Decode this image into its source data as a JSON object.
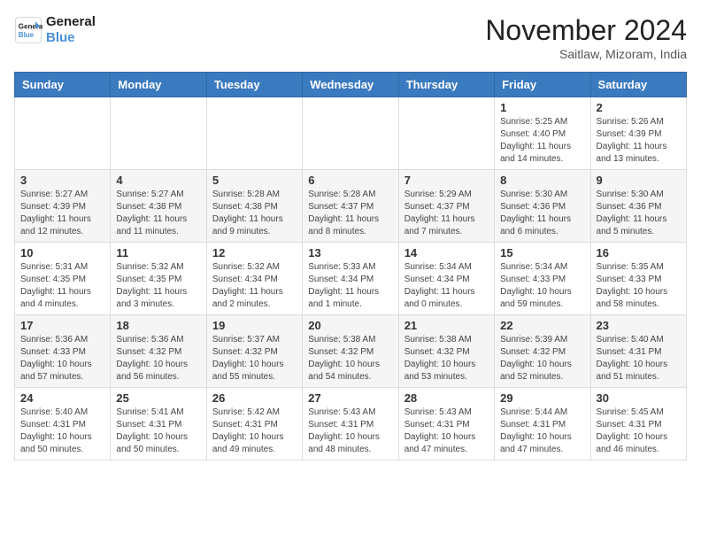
{
  "header": {
    "logo_line1": "General",
    "logo_line2": "Blue",
    "month_title": "November 2024",
    "location": "Saitlaw, Mizoram, India"
  },
  "weekdays": [
    "Sunday",
    "Monday",
    "Tuesday",
    "Wednesday",
    "Thursday",
    "Friday",
    "Saturday"
  ],
  "weeks": [
    [
      {
        "day": "",
        "info": ""
      },
      {
        "day": "",
        "info": ""
      },
      {
        "day": "",
        "info": ""
      },
      {
        "day": "",
        "info": ""
      },
      {
        "day": "",
        "info": ""
      },
      {
        "day": "1",
        "info": "Sunrise: 5:25 AM\nSunset: 4:40 PM\nDaylight: 11 hours and 14 minutes."
      },
      {
        "day": "2",
        "info": "Sunrise: 5:26 AM\nSunset: 4:39 PM\nDaylight: 11 hours and 13 minutes."
      }
    ],
    [
      {
        "day": "3",
        "info": "Sunrise: 5:27 AM\nSunset: 4:39 PM\nDaylight: 11 hours and 12 minutes."
      },
      {
        "day": "4",
        "info": "Sunrise: 5:27 AM\nSunset: 4:38 PM\nDaylight: 11 hours and 11 minutes."
      },
      {
        "day": "5",
        "info": "Sunrise: 5:28 AM\nSunset: 4:38 PM\nDaylight: 11 hours and 9 minutes."
      },
      {
        "day": "6",
        "info": "Sunrise: 5:28 AM\nSunset: 4:37 PM\nDaylight: 11 hours and 8 minutes."
      },
      {
        "day": "7",
        "info": "Sunrise: 5:29 AM\nSunset: 4:37 PM\nDaylight: 11 hours and 7 minutes."
      },
      {
        "day": "8",
        "info": "Sunrise: 5:30 AM\nSunset: 4:36 PM\nDaylight: 11 hours and 6 minutes."
      },
      {
        "day": "9",
        "info": "Sunrise: 5:30 AM\nSunset: 4:36 PM\nDaylight: 11 hours and 5 minutes."
      }
    ],
    [
      {
        "day": "10",
        "info": "Sunrise: 5:31 AM\nSunset: 4:35 PM\nDaylight: 11 hours and 4 minutes."
      },
      {
        "day": "11",
        "info": "Sunrise: 5:32 AM\nSunset: 4:35 PM\nDaylight: 11 hours and 3 minutes."
      },
      {
        "day": "12",
        "info": "Sunrise: 5:32 AM\nSunset: 4:34 PM\nDaylight: 11 hours and 2 minutes."
      },
      {
        "day": "13",
        "info": "Sunrise: 5:33 AM\nSunset: 4:34 PM\nDaylight: 11 hours and 1 minute."
      },
      {
        "day": "14",
        "info": "Sunrise: 5:34 AM\nSunset: 4:34 PM\nDaylight: 11 hours and 0 minutes."
      },
      {
        "day": "15",
        "info": "Sunrise: 5:34 AM\nSunset: 4:33 PM\nDaylight: 10 hours and 59 minutes."
      },
      {
        "day": "16",
        "info": "Sunrise: 5:35 AM\nSunset: 4:33 PM\nDaylight: 10 hours and 58 minutes."
      }
    ],
    [
      {
        "day": "17",
        "info": "Sunrise: 5:36 AM\nSunset: 4:33 PM\nDaylight: 10 hours and 57 minutes."
      },
      {
        "day": "18",
        "info": "Sunrise: 5:36 AM\nSunset: 4:32 PM\nDaylight: 10 hours and 56 minutes."
      },
      {
        "day": "19",
        "info": "Sunrise: 5:37 AM\nSunset: 4:32 PM\nDaylight: 10 hours and 55 minutes."
      },
      {
        "day": "20",
        "info": "Sunrise: 5:38 AM\nSunset: 4:32 PM\nDaylight: 10 hours and 54 minutes."
      },
      {
        "day": "21",
        "info": "Sunrise: 5:38 AM\nSunset: 4:32 PM\nDaylight: 10 hours and 53 minutes."
      },
      {
        "day": "22",
        "info": "Sunrise: 5:39 AM\nSunset: 4:32 PM\nDaylight: 10 hours and 52 minutes."
      },
      {
        "day": "23",
        "info": "Sunrise: 5:40 AM\nSunset: 4:31 PM\nDaylight: 10 hours and 51 minutes."
      }
    ],
    [
      {
        "day": "24",
        "info": "Sunrise: 5:40 AM\nSunset: 4:31 PM\nDaylight: 10 hours and 50 minutes."
      },
      {
        "day": "25",
        "info": "Sunrise: 5:41 AM\nSunset: 4:31 PM\nDaylight: 10 hours and 50 minutes."
      },
      {
        "day": "26",
        "info": "Sunrise: 5:42 AM\nSunset: 4:31 PM\nDaylight: 10 hours and 49 minutes."
      },
      {
        "day": "27",
        "info": "Sunrise: 5:43 AM\nSunset: 4:31 PM\nDaylight: 10 hours and 48 minutes."
      },
      {
        "day": "28",
        "info": "Sunrise: 5:43 AM\nSunset: 4:31 PM\nDaylight: 10 hours and 47 minutes."
      },
      {
        "day": "29",
        "info": "Sunrise: 5:44 AM\nSunset: 4:31 PM\nDaylight: 10 hours and 47 minutes."
      },
      {
        "day": "30",
        "info": "Sunrise: 5:45 AM\nSunset: 4:31 PM\nDaylight: 10 hours and 46 minutes."
      }
    ]
  ]
}
